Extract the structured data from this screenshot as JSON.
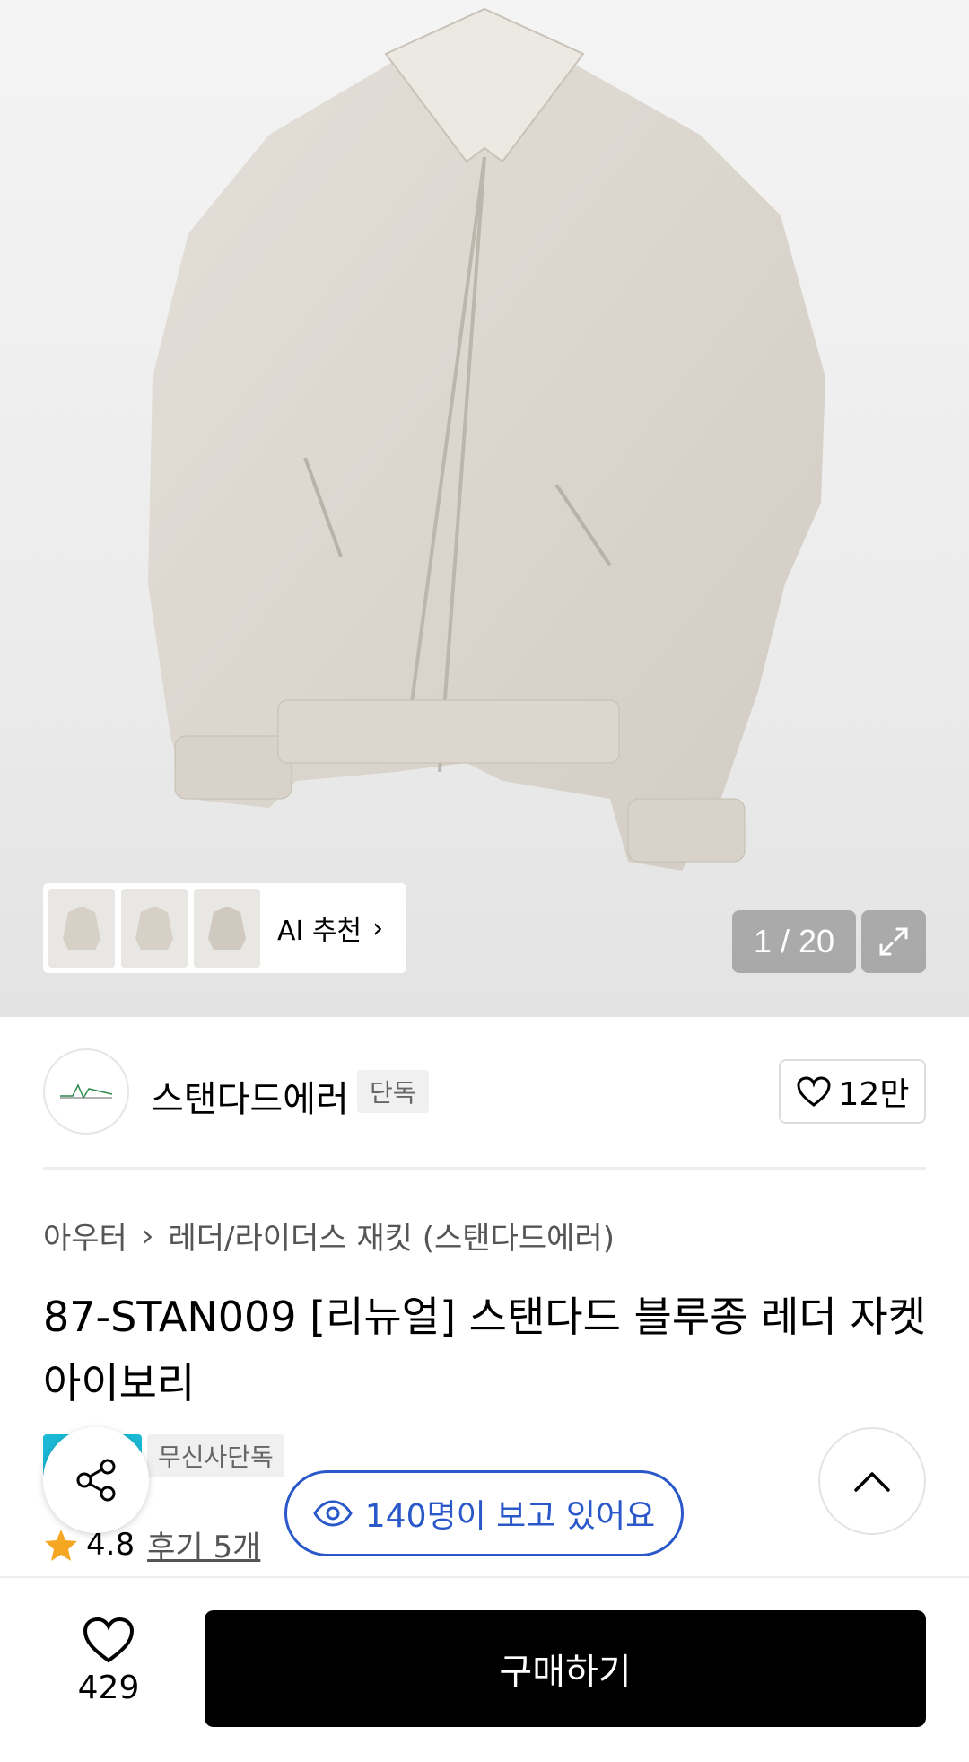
{
  "gallery": {
    "counter": "1 / 20",
    "ai_recommend_label": "AI 추천",
    "thumbnails": [
      "thumb-1",
      "thumb-2",
      "thumb-3"
    ]
  },
  "brand": {
    "name": "스탠다드에러",
    "badge": "단독",
    "follow_count": "12만"
  },
  "breadcrumb": {
    "category": "아우터",
    "subcategory": "레더/라이더스 재킷 (스탠다드에러)"
  },
  "product": {
    "title": "87-STAN009 [리뉴얼] 스탠다드 블루종 레더 자켓 아이보리",
    "tag": "무신사단독",
    "rating": "4.8",
    "reviews": "후기 5개"
  },
  "viewers": {
    "text": "140명이 보고 있어요"
  },
  "bottom_bar": {
    "like_count": "429",
    "buy_label": "구매하기"
  },
  "colors": {
    "accent_blue": "#2a58c9",
    "star": "#f5a623",
    "buy_button": "#000000"
  }
}
